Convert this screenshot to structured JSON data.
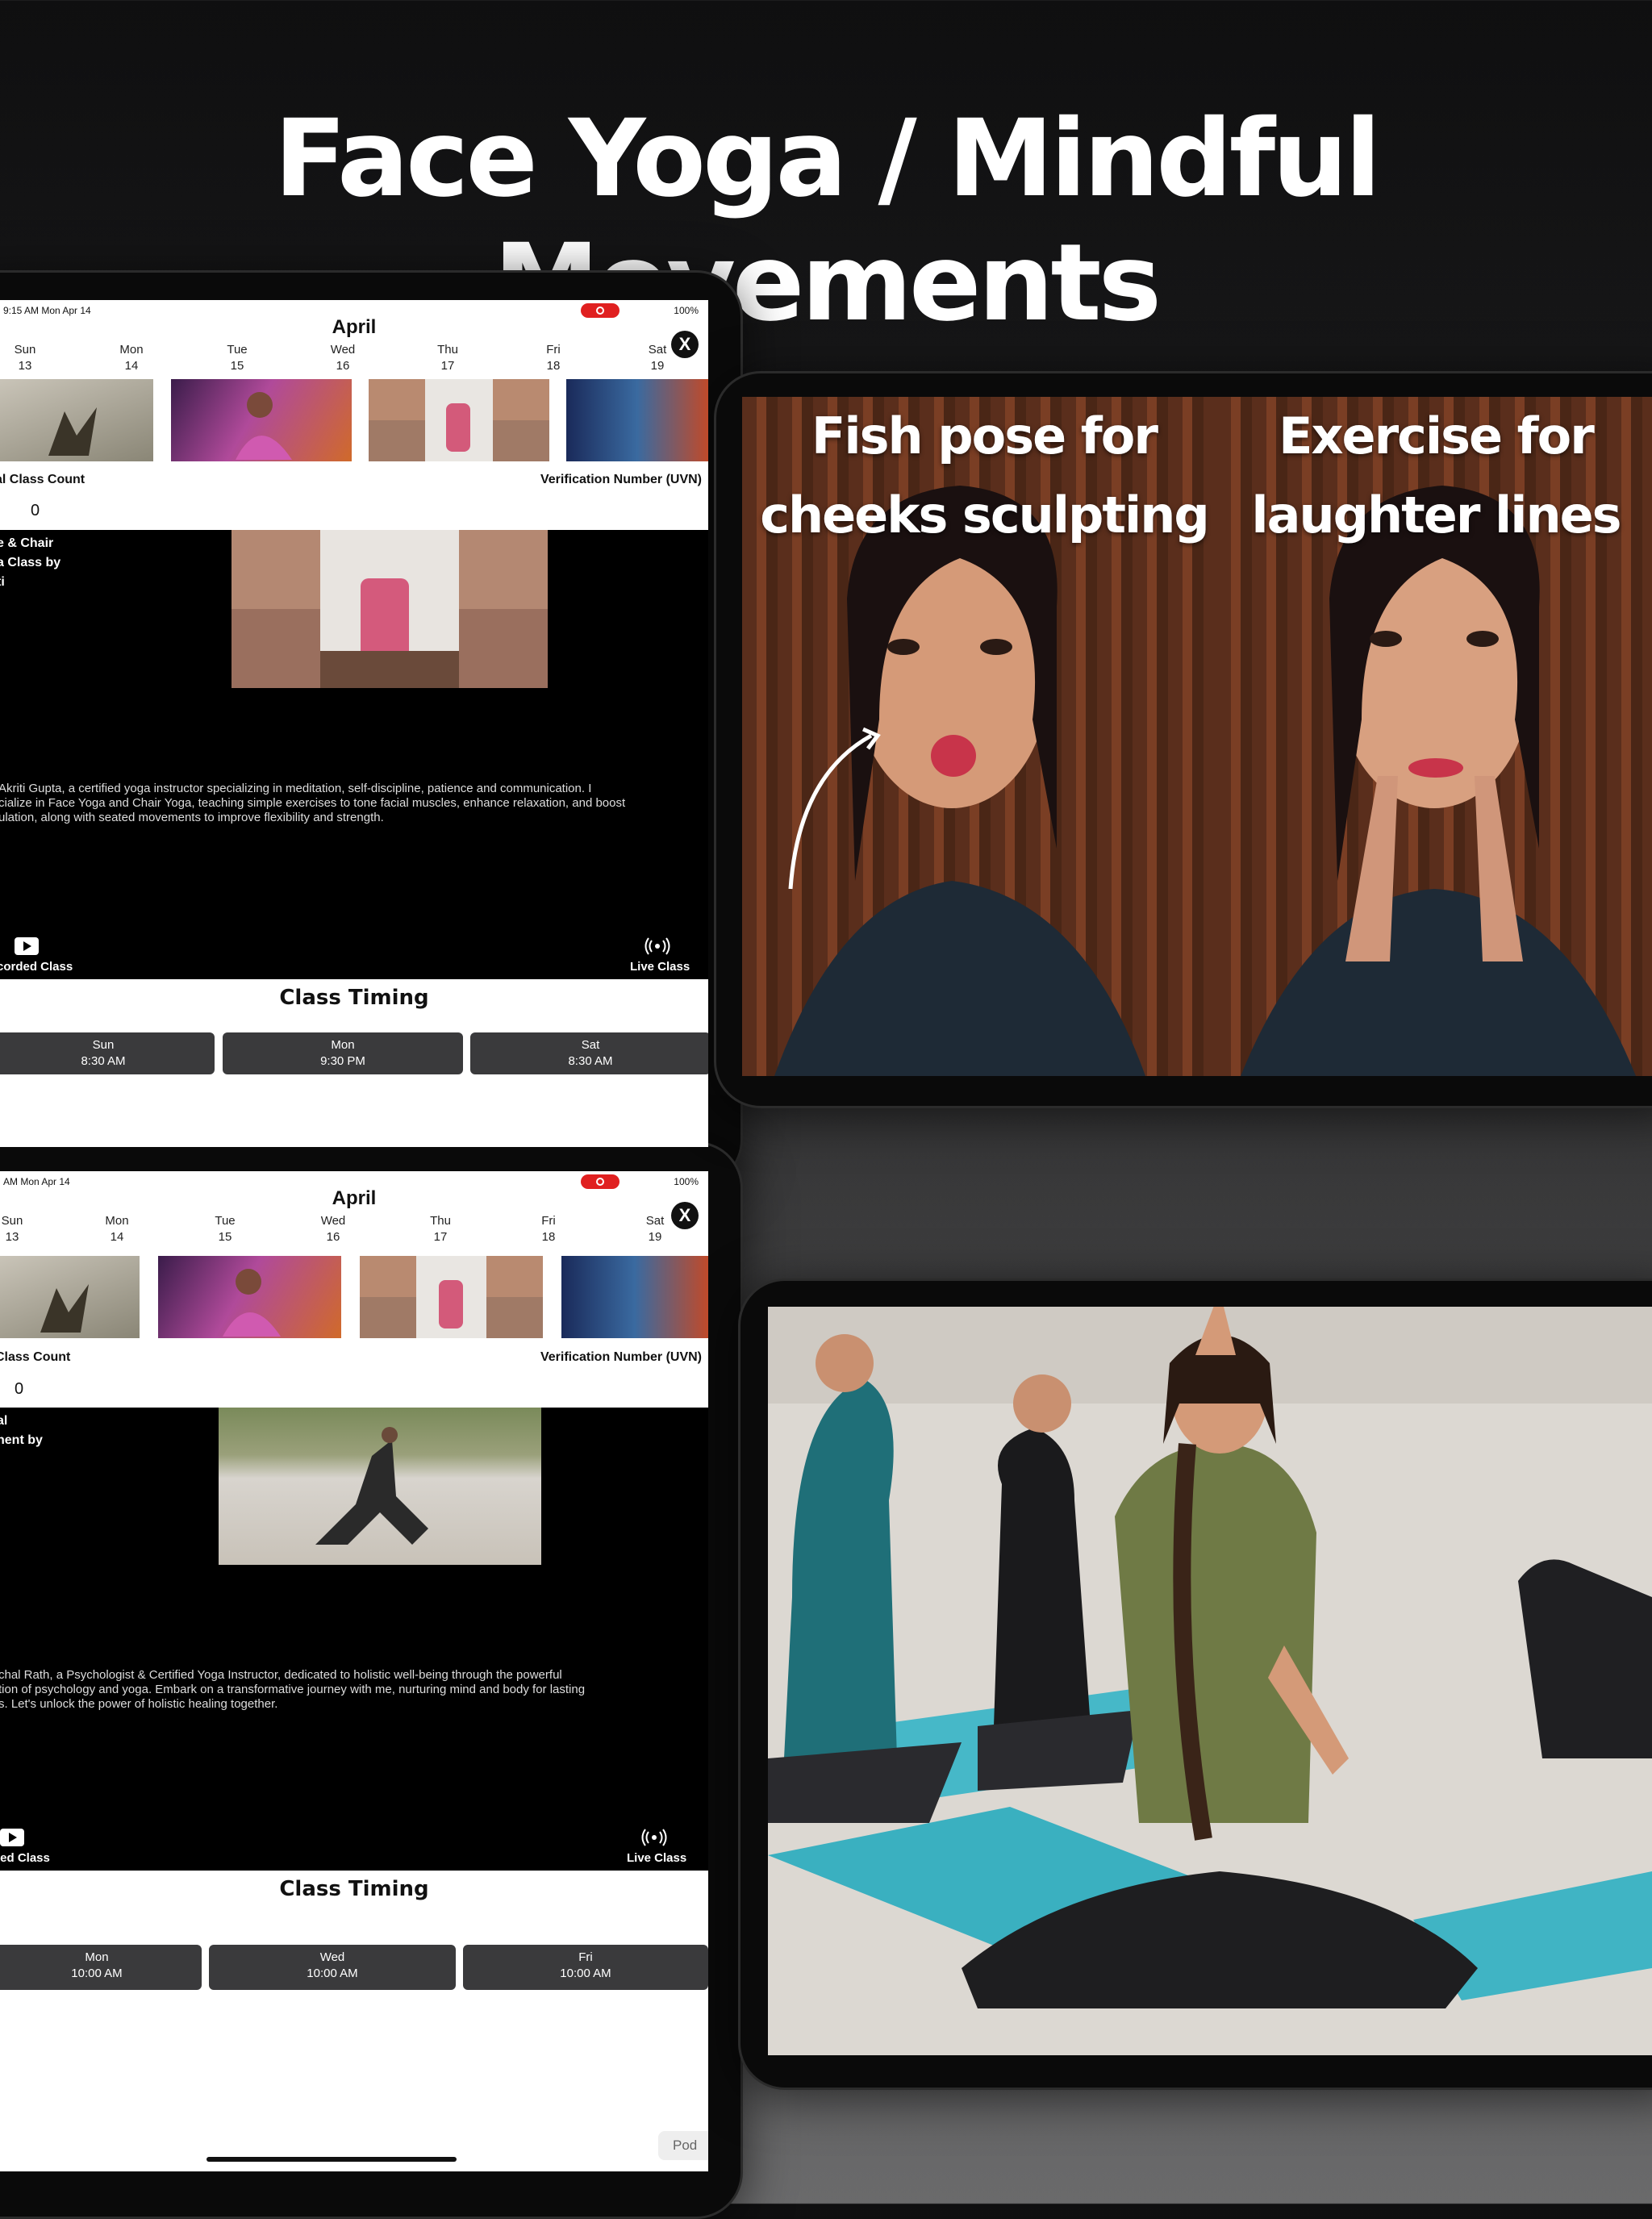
{
  "headline": "Face Yoga / Mindful Movements",
  "captions": {
    "left": "Fish pose for cheeks sculpting",
    "right": "Exercise for laughter lines"
  },
  "screen1": {
    "status": {
      "time": "9:15 AM  Mon Apr 14",
      "battery": "100%"
    },
    "month": "April",
    "close": "X",
    "days": [
      {
        "name": "Sun",
        "num": "13"
      },
      {
        "name": "Mon",
        "num": "14"
      },
      {
        "name": "Tue",
        "num": "15"
      },
      {
        "name": "Wed",
        "num": "16"
      },
      {
        "name": "Thu",
        "num": "17"
      },
      {
        "name": "Fri",
        "num": "18"
      },
      {
        "name": "Sat",
        "num": "19"
      }
    ],
    "class_count_label": "al Class Count",
    "class_count_value": "0",
    "uvn_label": "Verification Number (UVN)",
    "side_title": "e & Chair\na Class by\nti",
    "description": " Akriti Gupta, a certified yoga instructor specializing in meditation, self-discipline, patience and communication.  I\ncialize in Face Yoga and Chair Yoga, teaching simple exercises to tone facial muscles, enhance relaxation, and boost\nulation, along with seated movements to improve flexibility and strength.",
    "recorded_label": "corded Class",
    "live_label": "Live Class",
    "timing_title": "Class Timing",
    "slots": [
      {
        "day": "Sun",
        "time": "8:30 AM"
      },
      {
        "day": "Mon",
        "time": "9:30 PM"
      },
      {
        "day": "Sat",
        "time": "8:30 AM"
      }
    ]
  },
  "screen2": {
    "status": {
      "time": "AM  Mon Apr 14",
      "battery": "100%"
    },
    "month": "April",
    "close": "X",
    "days": [
      {
        "name": "Sun",
        "num": "13"
      },
      {
        "name": "Mon",
        "num": "14"
      },
      {
        "name": "Tue",
        "num": "15"
      },
      {
        "name": "Wed",
        "num": "16"
      },
      {
        "name": "Thu",
        "num": "17"
      },
      {
        "name": "Fri",
        "num": "18"
      },
      {
        "name": "Sat",
        "num": "19"
      }
    ],
    "class_count_label": "Class Count",
    "class_count_value": "0",
    "uvn_label": "Verification Number (UVN)",
    "side_title": "al\nnent by",
    "description": "chal Rath, a Psychologist & Certified Yoga Instructor, dedicated to holistic well-being through the powerful\ntion of psychology and yoga.  Embark on a transformative journey with me, nurturing mind and body for lasting\ns. Let's unlock the power of holistic healing together.",
    "recorded_label": "led Class",
    "live_label": "Live Class",
    "timing_title": "Class Timing",
    "slots": [
      {
        "day": "Mon",
        "time": "10:00 AM"
      },
      {
        "day": "Wed",
        "time": "10:00 AM"
      },
      {
        "day": "Fri",
        "time": "10:00 AM"
      }
    ],
    "pod_label": "Pod"
  },
  "colors": {
    "accent_red": "#e02020",
    "slot_bg": "#3a3a3c"
  },
  "icons": {
    "close": "close-icon",
    "play": "play-icon",
    "live": "broadcast-icon"
  }
}
